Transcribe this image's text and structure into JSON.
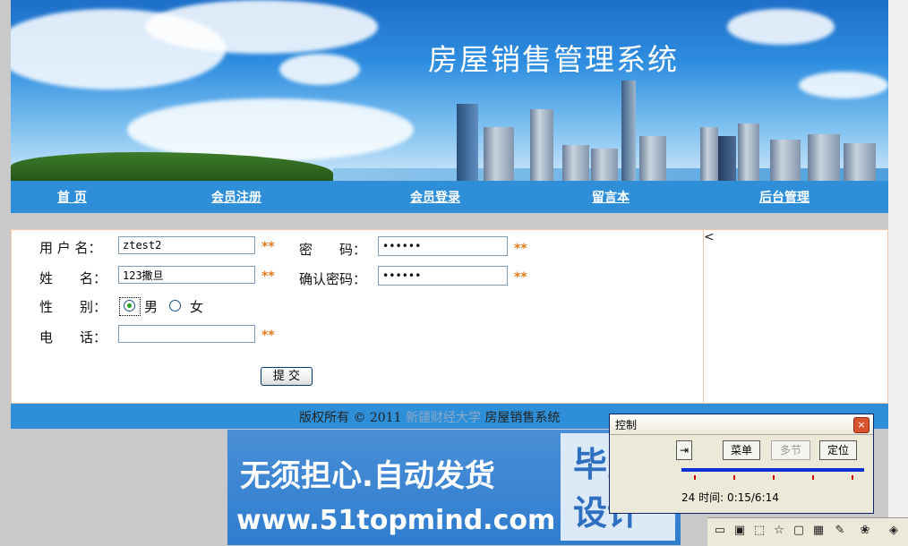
{
  "banner": {
    "title": "房屋销售管理系统"
  },
  "nav": {
    "items": [
      "首 页",
      "会员注册",
      "会员登录",
      "留言本",
      "后台管理"
    ]
  },
  "form": {
    "username_label": "用 户 名：",
    "username_value": "ztest2",
    "password_label": "密　　码：",
    "password_value": "••••••",
    "name_label": "姓　　名：",
    "name_value": "123撒旦",
    "confirm_label": "确认密码：",
    "confirm_value": "••••••",
    "gender_label": "性　　别：",
    "gender_male": "男",
    "gender_female": "女",
    "gender_selected": "男",
    "phone_label": "电　　话：",
    "phone_value": "",
    "required_mark": "**",
    "submit_label": "提 交",
    "side_glyph": "<"
  },
  "footer": {
    "prefix": "版权所有 © 2011",
    "university": "新疆财经大学",
    "suffix": "房屋销售系统"
  },
  "ad": {
    "main": "无须担心.自动发货",
    "url": "www.51topmind.com",
    "box_line1": "毕业",
    "box_line2": "设计"
  },
  "control": {
    "title": "控制",
    "close": "×",
    "btn_left": "⇥",
    "btn_menu": "菜单",
    "btn_multi": "多节",
    "btn_locate": "定位",
    "time_text": "24 时间: 0:15/6:14"
  },
  "colors": {
    "nav": "#2e8fd8",
    "required": "#e07a1c",
    "progress": "#0b2fd0"
  }
}
